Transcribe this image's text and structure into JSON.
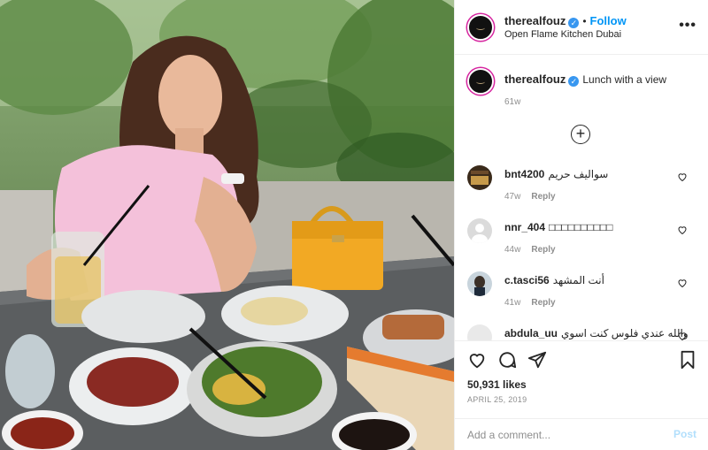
{
  "post": {
    "username": "therealfouz",
    "verified_mark": "✓",
    "separator": "•",
    "follow_label": "Follow",
    "location": "Open Flame Kitchen Dubai",
    "more_label": "•••",
    "caption_text": "Lunch with a view",
    "caption_time": "61w",
    "load_more_label": "+",
    "likes": "50,931 likes",
    "date": "APRIL 25, 2019"
  },
  "comments": [
    {
      "username": "bnt4200",
      "text": "سوالیف حریم",
      "time": "47w",
      "reply": "Reply"
    },
    {
      "username": "nnr_404",
      "text": "□□□□□□□□□□",
      "time": "44w",
      "reply": "Reply"
    },
    {
      "username": "c.tasci56",
      "text": "أنت المشهد",
      "time": "41w",
      "reply": "Reply"
    },
    {
      "username": "abdula_uu",
      "text": "والله عندي فلوس كنت اسوي",
      "time": "",
      "reply": ""
    }
  ],
  "comment_box": {
    "placeholder": "Add a comment...",
    "post_label": "Post"
  },
  "icons": [
    "more-icon",
    "verified-icon",
    "add-circle-icon",
    "heart-icon",
    "comment-icon",
    "share-icon",
    "bookmark-icon"
  ],
  "colors": {
    "accent": "#0095f6",
    "post_disabled": "#b2dffc",
    "muted": "#8e8e8e",
    "text": "#262626"
  }
}
